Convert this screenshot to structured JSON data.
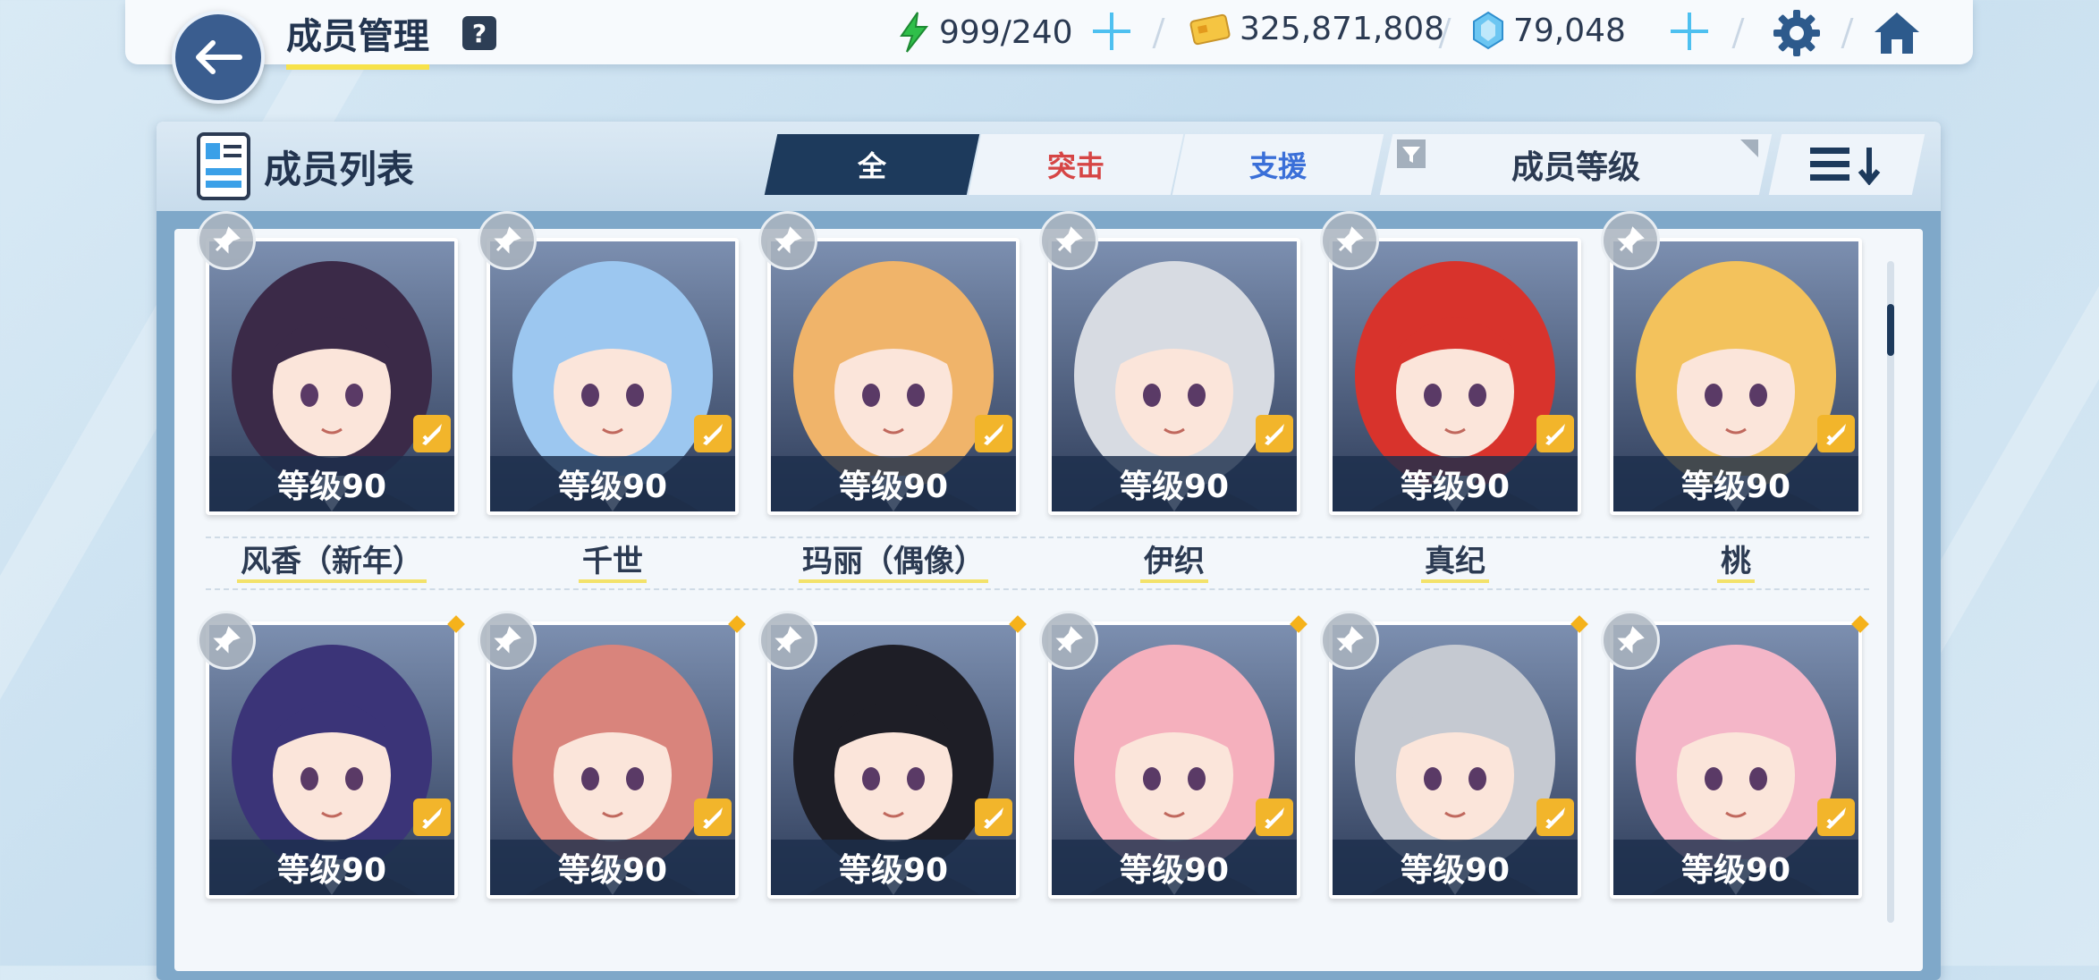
{
  "header": {
    "title": "成员管理",
    "help_label": "?",
    "ap": "999/240",
    "credits": "325,871,808",
    "gems": "79,048"
  },
  "panel": {
    "title": "成员列表",
    "tabs": [
      {
        "label": "全",
        "selected": true
      },
      {
        "label": "突击",
        "selected": false
      },
      {
        "label": "支援",
        "selected": false
      }
    ],
    "sort_label": "成员等级"
  },
  "colors": {
    "accent": "#1d3a5c",
    "striker": "#d64545",
    "special": "#3a6fd8",
    "level_band": "#1c2e4c",
    "role_badge": "#f2b52b"
  },
  "students_row1": [
    {
      "level": "等级90",
      "name": "风香（新年）",
      "hair": "#3b2a48"
    },
    {
      "level": "等级90",
      "name": "千世",
      "hair": "#9cc7f0"
    },
    {
      "level": "等级90",
      "name": "玛丽（偶像）",
      "hair": "#f0b46a"
    },
    {
      "level": "等级90",
      "name": "伊织",
      "hair": "#d7dbe2"
    },
    {
      "level": "等级90",
      "name": "真纪",
      "hair": "#d8332c"
    },
    {
      "level": "等级90",
      "name": "桃",
      "hair": "#f3c25c"
    }
  ],
  "students_row2": [
    {
      "level": "等级90",
      "hair": "#3b3478"
    },
    {
      "level": "等级90",
      "hair": "#d9847c"
    },
    {
      "level": "等级90",
      "hair": "#1e1e26"
    },
    {
      "level": "等级90",
      "hair": "#f5b0bd"
    },
    {
      "level": "等级90",
      "hair": "#c5c9d1"
    },
    {
      "level": "等级90",
      "hair": "#f4b6c8"
    }
  ]
}
